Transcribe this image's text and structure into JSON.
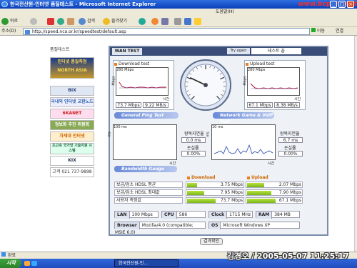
{
  "window": {
    "title": "한국전산원-인터넷 품질테스트 - Microsoft Internet Explorer",
    "watermark": "www.bcpark.net"
  },
  "menubar": {
    "help": "도움말(H)"
  },
  "toolbar": {
    "back": "뒤로",
    "search": "검색",
    "favorites": "즐겨찾기"
  },
  "address": {
    "label": "주소(D)",
    "url": "http://speed.nca.or.kr/speedtest/default.asp",
    "go": "이동",
    "links": "연결"
  },
  "sidebar": {
    "title": "품질테스트",
    "items": [
      "인터넷 품질측정 NORTH ASIA",
      "BIX",
      "국내외 인터넷 교환노드",
      "6KANET",
      "정보화 추진 위원회",
      "차세대 인터넷",
      "초고속 국가망 기술지원 시스템",
      "KIX",
      "고객 021 737-9898"
    ]
  },
  "test": {
    "tab": "WAN TEST",
    "try_again": "Try again",
    "try_value": "테스트 끝",
    "download": {
      "title": "Download test",
      "scale": "280 Mbps",
      "xlabel": "시간",
      "ylabel": "Mbps",
      "mbps": "73.7 Mbps",
      "mbytes": "9.22 MB/s"
    },
    "upload": {
      "title": "Upload test",
      "scale": "280 Mbps",
      "xlabel": "시간",
      "ylabel": "Mbps",
      "mbps": "67.1 Mbps",
      "mbytes": "8.38 MB/s"
    },
    "ping": {
      "header": "General Ping Test",
      "scale": "100 ms",
      "xlabel": "시간",
      "ylabel": "ms",
      "avg_label": "왕복지연율",
      "avg": "0.0 ms",
      "loss_label": "손실률",
      "loss": "0.00%"
    },
    "game": {
      "header": "Network Game & VoIP Test",
      "scale": "10 ms",
      "xlabel": "시간",
      "ylabel": "ms",
      "avg_label": "왕복지연율",
      "avg": "6.7 ms",
      "loss_label": "손실률",
      "loss": "0.00%"
    },
    "bandwidth": {
      "header": "Bandwidth Gauge",
      "download_label": "Download",
      "upload_label": "Upload",
      "rows": [
        {
          "name": "보급/업소 HDSL 평균",
          "down": "3.75 Mbps",
          "down_frac": 0.35,
          "up": "2.07 Mbps",
          "up_frac": 0.6
        },
        {
          "name": "보급/업소 HDSL 최대값",
          "down": "7.95 Mbps",
          "down_frac": 0.6,
          "up": "7.90 Mbps",
          "up_frac": 0.85
        },
        {
          "name": "사용자 측정값",
          "down": "73.7 Mbps",
          "down_frac": 1.0,
          "up": "67.1 Mbps",
          "up_frac": 1.0
        }
      ]
    },
    "sysinfo": {
      "lan_label": "LAN",
      "lan": "100 Mbps",
      "cpu_label": "CPU",
      "cpu": "586",
      "clock_label": "Clock",
      "clock": "1715 MHz",
      "ram_label": "RAM",
      "ram": "384 MB",
      "browser_label": "Browser",
      "browser": "Mozilla/4.0 (compatible; MSIE 6.0)",
      "os_label": "OS",
      "os": "Microsoft Windows XP"
    },
    "confirm": "결과확인",
    "gauge_value_frac": 0.26
  },
  "status": {
    "text": "완료"
  },
  "taskbar": {
    "start": "시작",
    "item": "한국전산원-인..."
  },
  "stamp": "김경오 / 2005-05-07 11:25:17",
  "colors": {
    "accent": "#3a4d78",
    "bar": "#9ed030",
    "titlebar": "#0a3fb8"
  }
}
